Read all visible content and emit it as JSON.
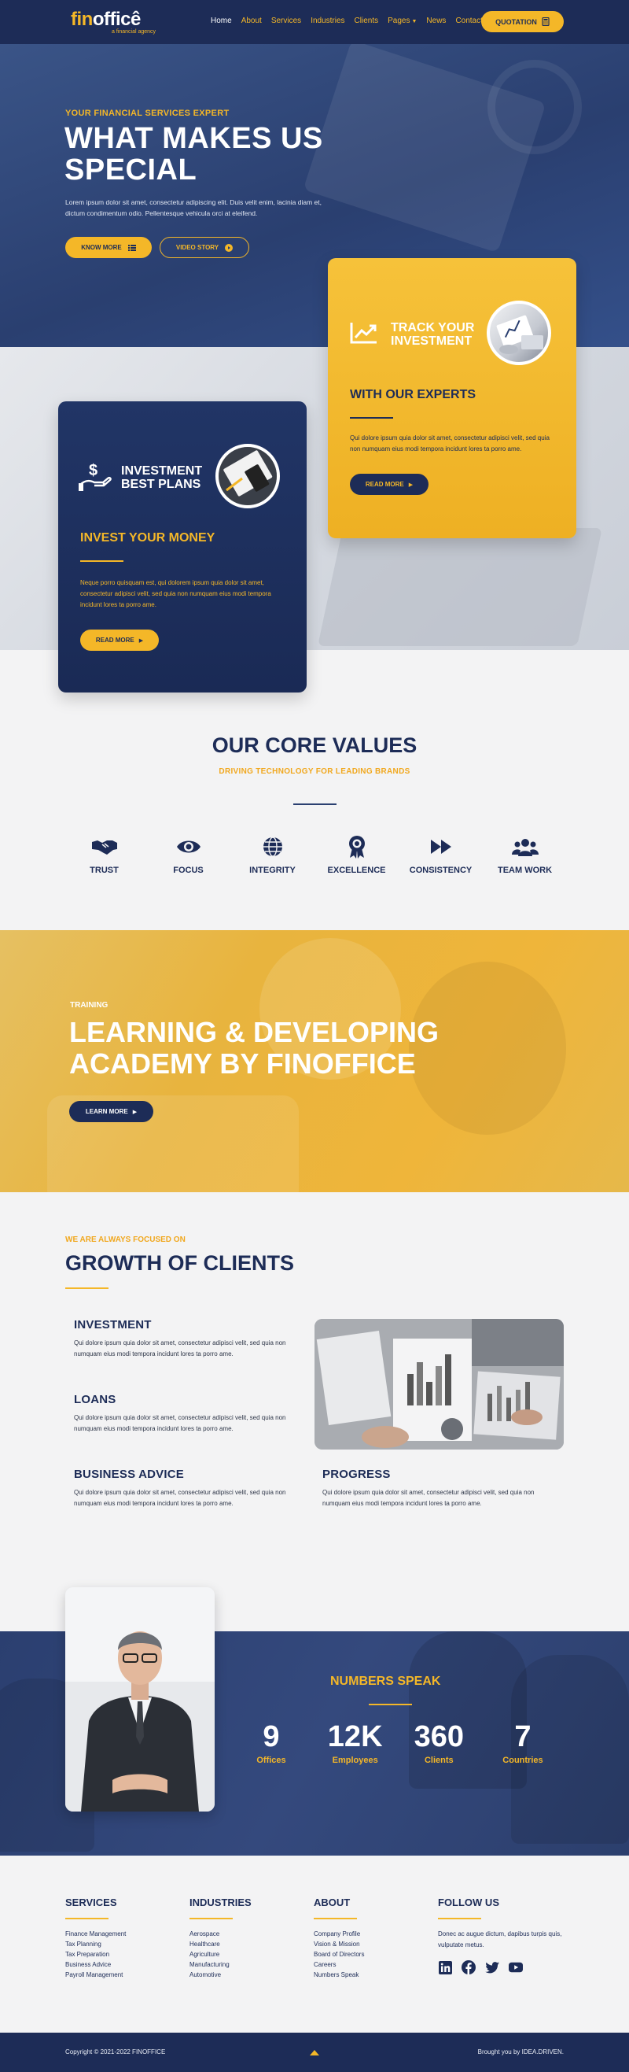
{
  "header": {
    "logo_primary": "fin",
    "logo_secondary": "officê",
    "logo_tagline": "a financial agency",
    "nav": [
      {
        "label": "Home"
      },
      {
        "label": "About"
      },
      {
        "label": "Services"
      },
      {
        "label": "Industries"
      },
      {
        "label": "Clients"
      },
      {
        "label": "Pages"
      },
      {
        "label": "News"
      },
      {
        "label": "Contact"
      }
    ],
    "quote_label": "QUOTATION"
  },
  "hero": {
    "eyebrow": "YOUR FINANCIAL SERVICES EXPERT",
    "title": "WHAT MAKES US SPECIAL",
    "text": "Lorem ipsum dolor sit amet, consectetur adipiscing elit. Duis velit enim, lacinia diam et, dictum condimentum odio. Pellentesque vehicula orci at eleifend.",
    "know_more": "KNOW MORE",
    "video_story": "VIDEO STORY"
  },
  "card_track": {
    "title_line1": "TRACK YOUR",
    "title_line2": "INVESTMENT",
    "subtitle": "WITH OUR EXPERTS",
    "body": "Qui dolore ipsum quia dolor sit amet, consectetur adipisci velit, sed quia non numquam eius modi tempora incidunt lores ta porro ame.",
    "button": "READ MORE"
  },
  "card_invest": {
    "title_line1": "INVESTMENT",
    "title_line2": "BEST PLANS",
    "subtitle": "INVEST YOUR MONEY",
    "body": "Neque porro quisquam est, qui dolorem ipsum quia dolor sit amet, consectetur adipisci velit, sed quia non numquam eius modi tempora incidunt lores ta porro ame.",
    "button": "READ MORE"
  },
  "core_values": {
    "title": "OUR CORE VALUES",
    "subtitle": "DRIVING TECHNOLOGY FOR LEADING BRANDS",
    "items": [
      {
        "label": "TRUST",
        "icon": "handshake-icon"
      },
      {
        "label": "FOCUS",
        "icon": "eye-icon"
      },
      {
        "label": "INTEGRITY",
        "icon": "globe-icon"
      },
      {
        "label": "EXCELLENCE",
        "icon": "award-icon"
      },
      {
        "label": "CONSISTENCY",
        "icon": "fast-forward-icon"
      },
      {
        "label": "TEAM WORK",
        "icon": "users-icon"
      }
    ]
  },
  "academy": {
    "eyebrow": "TRAINING",
    "title": "LEARNING & DEVELOPING ACADEMY BY FINOFFICE",
    "button": "LEARN MORE"
  },
  "growth": {
    "eyebrow": "WE ARE ALWAYS FOCUSED ON",
    "title": "GROWTH OF CLIENTS",
    "blocks": [
      {
        "title": "INVESTMENT",
        "text": "Qui dolore ipsum quia dolor sit amet, consectetur adipisci velit, sed quia non numquam eius modi tempora incidunt lores ta porro ame."
      },
      {
        "title": "LOANS",
        "text": "Qui dolore ipsum quia dolor sit amet, consectetur adipisci velit, sed quia non numquam eius modi tempora incidunt lores ta porro ame."
      },
      {
        "title": "BUSINESS ADVICE",
        "text": "Qui dolore ipsum quia dolor sit amet, consectetur adipisci velit, sed quia non numquam eius modi tempora incidunt lores ta porro ame."
      },
      {
        "title": "PROGRESS",
        "text": "Qui dolore ipsum quia dolor sit amet, consectetur adipisci velit, sed quia non numquam eius modi tempora incidunt lores ta porro ame."
      }
    ]
  },
  "numbers": {
    "title": "NUMBERS SPEAK",
    "stats": [
      {
        "value": "9",
        "label": "Offices"
      },
      {
        "value": "12K",
        "label": "Employees"
      },
      {
        "value": "360",
        "label": "Clients"
      },
      {
        "value": "7",
        "label": "Countries"
      }
    ]
  },
  "footer": {
    "services": {
      "title": "SERVICES",
      "links": [
        "Finance Management",
        "Tax Planning",
        "Tax Preparation",
        "Business Advice",
        "Payroll Management"
      ]
    },
    "industries": {
      "title": "INDUSTRIES",
      "links": [
        "Aerospace",
        "Healthcare",
        "Agriculture",
        "Manufacturing",
        "Automotive"
      ]
    },
    "about": {
      "title": "ABOUT",
      "links": [
        "Company Profile",
        "Vision & Mission",
        "Board of Directors",
        "Careers",
        "Numbers Speak"
      ]
    },
    "follow": {
      "title": "FOLLOW US",
      "text": "Donec ac augue dictum, dapibus turpis quis, vulputate metus.",
      "socials": [
        "linkedin-icon",
        "facebook-icon",
        "twitter-icon",
        "youtube-icon"
      ]
    },
    "copyright": "Copyright © 2021-2022 FINOFFICE",
    "brought": "Brought you by IDEA.DRIVEN."
  },
  "colors": {
    "navy": "#1d2c57",
    "accent": "#f4b728",
    "background": "#f3f3f4"
  }
}
